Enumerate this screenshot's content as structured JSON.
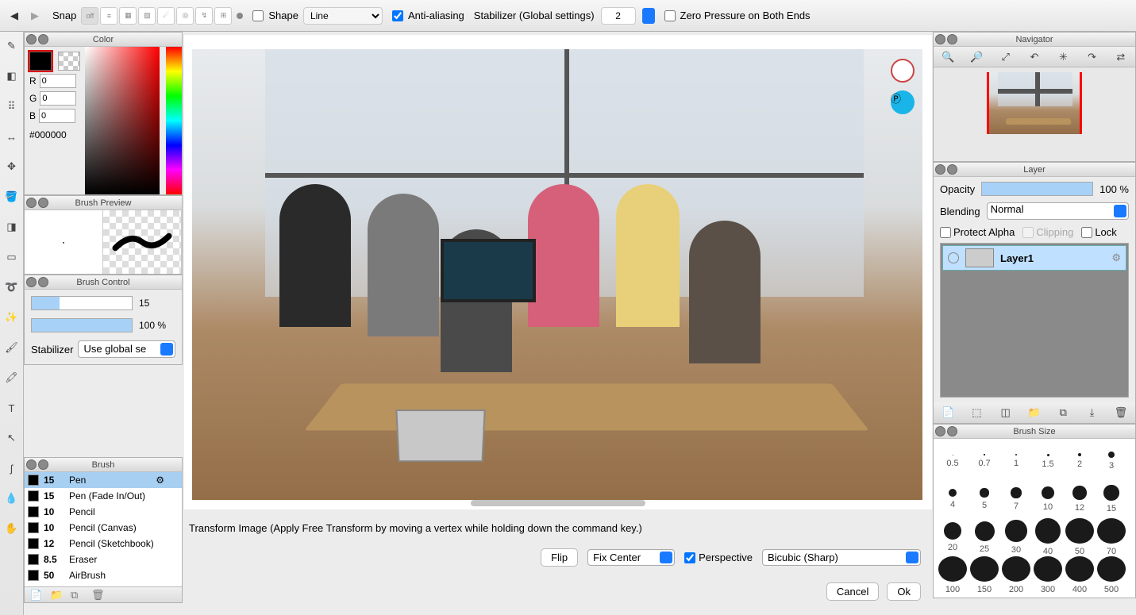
{
  "toolbar": {
    "snap": "Snap",
    "snap_off": "off",
    "shape_label": "Shape",
    "shape_value": "Line",
    "antialias": "Anti-aliasing",
    "stabilizer": "Stabilizer (Global settings)",
    "stabilizer_value": "2",
    "zeropress": "Zero Pressure on Both Ends"
  },
  "panels": {
    "color": {
      "title": "Color",
      "r_label": "R",
      "g_label": "G",
      "b_label": "B",
      "r": "0",
      "g": "0",
      "b": "0",
      "hex": "#000000"
    },
    "brush_preview": {
      "title": "Brush Preview"
    },
    "brush_control": {
      "title": "Brush Control",
      "size": "15",
      "opacity": "100 %",
      "stab_label": "Stabilizer",
      "stab_value": "Use global se"
    },
    "brush": {
      "title": "Brush",
      "items": [
        {
          "size": "15",
          "name": "Pen",
          "sel": true
        },
        {
          "size": "15",
          "name": "Pen (Fade In/Out)"
        },
        {
          "size": "10",
          "name": "Pencil"
        },
        {
          "size": "10",
          "name": "Pencil (Canvas)"
        },
        {
          "size": "12",
          "name": "Pencil (Sketchbook)"
        },
        {
          "size": "8.5",
          "name": "Eraser"
        },
        {
          "size": "50",
          "name": "AirBrush"
        }
      ]
    },
    "navigator": {
      "title": "Navigator"
    },
    "layer": {
      "title": "Layer",
      "opacity_label": "Opacity",
      "opacity_val": "100 %",
      "blend_label": "Blending",
      "blend_val": "Normal",
      "protect": "Protect Alpha",
      "clipping": "Clipping",
      "lock": "Lock",
      "layer1": "Layer1"
    },
    "brush_size": {
      "title": "Brush Size",
      "sizes": [
        {
          "d": 0.5,
          "l": "0.5"
        },
        {
          "d": 0.7,
          "l": "0.7"
        },
        {
          "d": 1,
          "l": "1"
        },
        {
          "d": 1.5,
          "l": "1.5"
        },
        {
          "d": 2,
          "l": "2"
        },
        {
          "d": 3,
          "l": "3"
        },
        {
          "d": 4,
          "l": "4"
        },
        {
          "d": 5,
          "l": "5"
        },
        {
          "d": 7,
          "l": "7"
        },
        {
          "d": 10,
          "l": "10"
        },
        {
          "d": 12,
          "l": "12"
        },
        {
          "d": 15,
          "l": "15"
        },
        {
          "d": 20,
          "l": "20"
        },
        {
          "d": 25,
          "l": "25"
        },
        {
          "d": 30,
          "l": "30"
        },
        {
          "d": 40,
          "l": "40"
        },
        {
          "d": 50,
          "l": "50"
        },
        {
          "d": 70,
          "l": "70"
        },
        {
          "d": 100,
          "l": "100"
        },
        {
          "d": 150,
          "l": "150"
        },
        {
          "d": 200,
          "l": "200"
        },
        {
          "d": 300,
          "l": "300"
        },
        {
          "d": 400,
          "l": "400"
        },
        {
          "d": 500,
          "l": "500"
        }
      ]
    }
  },
  "transform": {
    "hint": "Transform Image (Apply Free Transform by moving a vertex while holding down the command key.)",
    "flip": "Flip",
    "fix_center": "Fix Center",
    "perspective": "Perspective",
    "interp": "Bicubic (Sharp)",
    "cancel": "Cancel",
    "ok": "Ok"
  }
}
